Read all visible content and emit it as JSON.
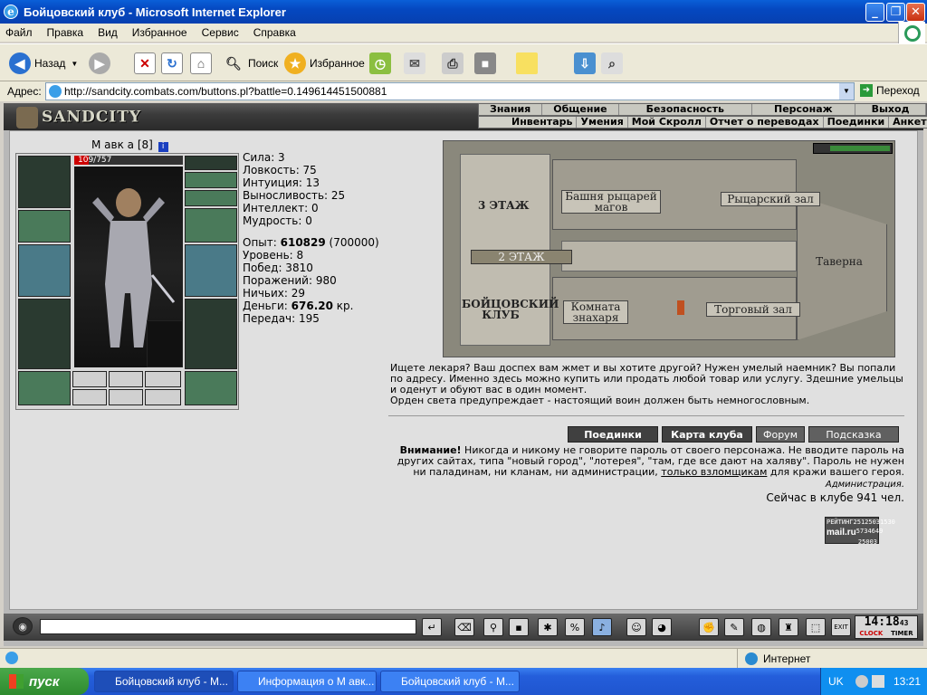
{
  "window": {
    "title": "Бойцовский клуб - Microsoft Internet Explorer"
  },
  "menu": [
    "Файл",
    "Правка",
    "Вид",
    "Избранное",
    "Сервис",
    "Справка"
  ],
  "toolbar": {
    "back": "Назад",
    "search": "Поиск",
    "favorites": "Избранное"
  },
  "address": {
    "label": "Адрес:",
    "url": "http://sandcity.combats.com/buttons.pl?battle=0.149614451500881",
    "go": "Переход"
  },
  "game": {
    "logo": "SANDCITY",
    "nav1": [
      "Знания",
      "Общение",
      "Безопасность",
      "Персонаж",
      "Выход"
    ],
    "nav2": [
      "Инвентарь",
      "Умения",
      "Мой Скролл",
      "Отчет о переводах",
      "Поединки",
      "Анкета"
    ],
    "character": {
      "name": "М авк а",
      "level": "[8]",
      "hp": "109/757"
    },
    "stats": {
      "str": "Сила: 3",
      "agi": "Ловкость: 75",
      "int": "Интуиция: 13",
      "end": "Выносливость: 25",
      "intel": "Интеллект: 0",
      "wis": "Мудрость: 0",
      "exp_label": "Опыт: ",
      "exp": "610829",
      "exp_next": " (700000)",
      "level": "Уровень: 8",
      "wins": "Побед: 3810",
      "losses": "Поражений: 980",
      "draws": "Ничьих: 29",
      "money_label": "Деньги: ",
      "money": "676.20",
      "money_unit": " кр.",
      "transfers": "Передач: 195"
    },
    "map": {
      "floor3": "3 ЭТАЖ",
      "floor2": "2 ЭТАЖ",
      "club": "БОЙЦОВСКИЙ КЛУБ",
      "tower": "Башня рыцарей магов",
      "knight_hall": "Рыцарский зал",
      "tavern": "Таверна",
      "healer": "Комната знахаря",
      "trade": "Торговый зал"
    },
    "description": "Ищете лекаря? Ваш доспех вам жмет и вы хотите другой? Нужен умелый наемник? Вы попали по адресу. Именно здесь можно купить или продать любой товар или услугу. Здешние умельцы и оденут и обуют вас в один момент.",
    "description2": "Орден света предупреждает - настоящий воин должен быть немногословным.",
    "buttons": {
      "battles": "Поединки",
      "map": "Карта клуба",
      "forum": "Форум",
      "hint": "Подсказка"
    },
    "warning": {
      "bold": "Внимание!",
      "text": " Никогда и никому не говорите пароль от своего персонажа. Не вводите пароль на других сайтах, типа \"новый город\", \"лотерея\", \"там, где все дают на халяву\". Пароль не нужен ни паладинам, ни кланам, ни администрации, ",
      "link": "только взломщикам",
      "tail": " для кражи вашего героя."
    },
    "admin": "Администрация.",
    "online": "Сейчас в клубе 941 чел.",
    "rating": {
      "title": "РЕЙТИНГ",
      "n1": "25125031530",
      "brand": "mail.ru",
      "n2": "5734649",
      "n3": "25003"
    },
    "clock": {
      "time": "14:18",
      "sec": "43",
      "clock_label": "CLOCK",
      "timer_label": "TIMER"
    }
  },
  "status": {
    "zone": "Интернет"
  },
  "taskbar": {
    "start": "пуск",
    "tasks": [
      "Бойцовский клуб - М...",
      "Информация о М авк...",
      "Бойцовский клуб - М..."
    ],
    "lang": "UK",
    "time": "13:21"
  }
}
